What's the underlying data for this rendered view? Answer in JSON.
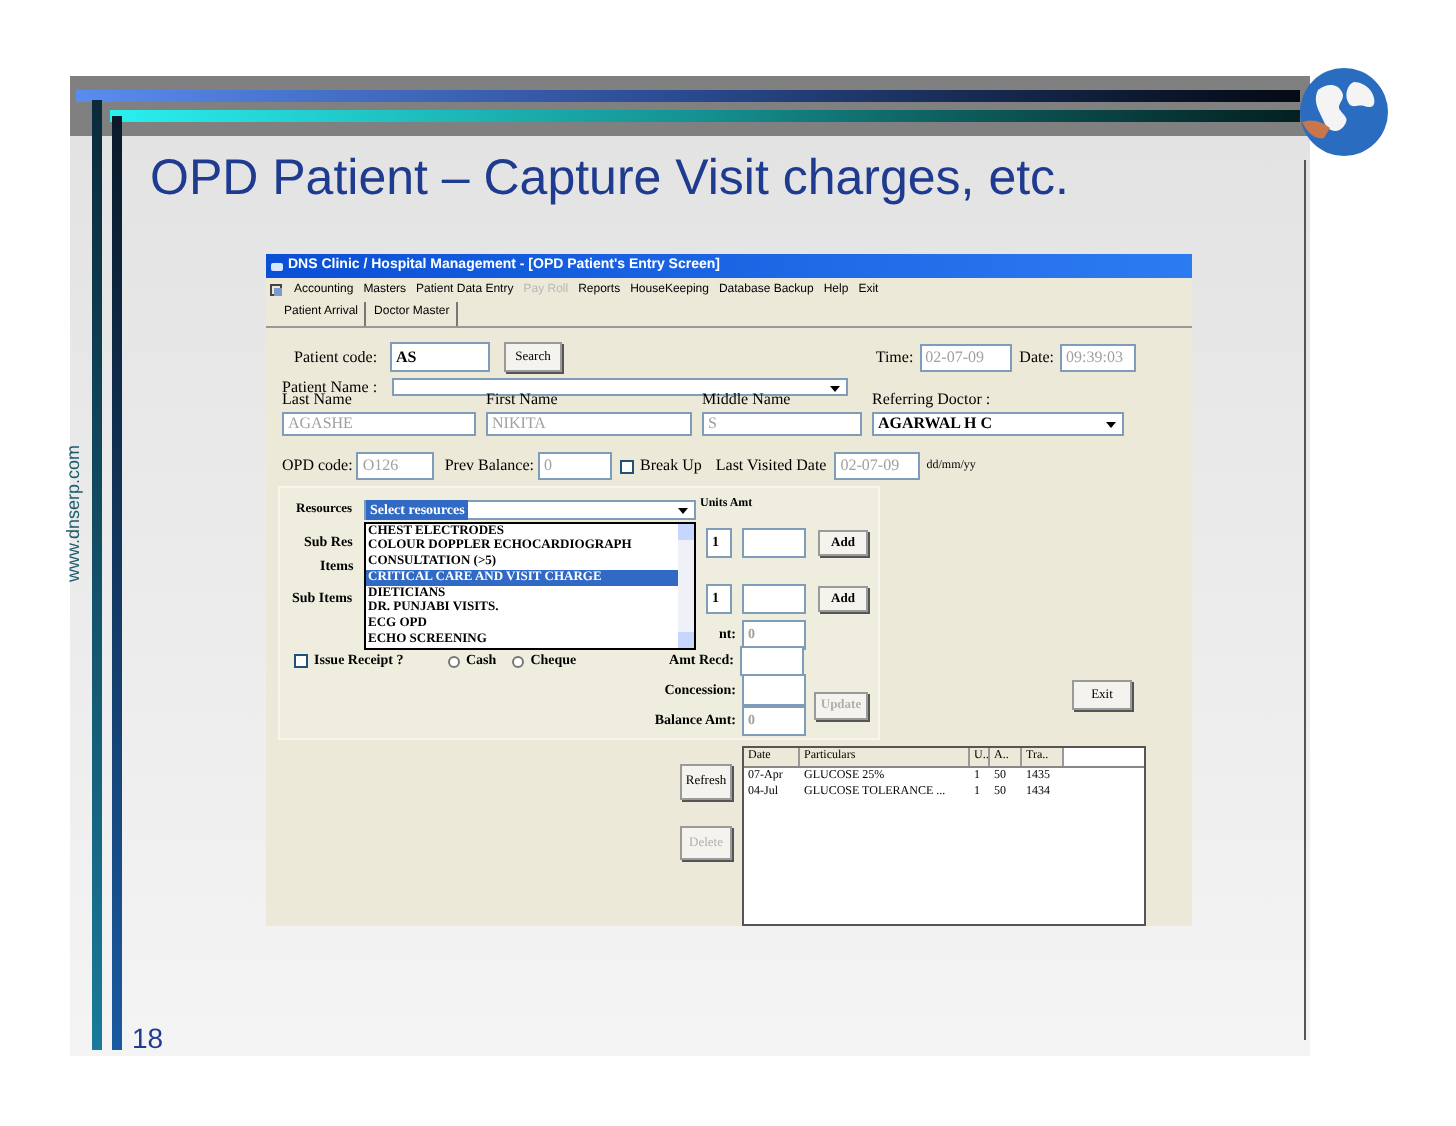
{
  "slide": {
    "title": "OPD Patient – Capture Visit charges, etc.",
    "page_number": "18",
    "side_text": "www.dnserp.com"
  },
  "window": {
    "title": "DNS Clinic / Hospital Management - [OPD Patient's Entry Screen]",
    "menu": [
      {
        "label": "Accounting",
        "disabled": false
      },
      {
        "label": "Masters",
        "disabled": false
      },
      {
        "label": "Patient Data Entry",
        "disabled": false
      },
      {
        "label": "Pay Roll",
        "disabled": true
      },
      {
        "label": "Reports",
        "disabled": false
      },
      {
        "label": "HouseKeeping",
        "disabled": false
      },
      {
        "label": "Database Backup",
        "disabled": false
      },
      {
        "label": "Help",
        "disabled": false
      },
      {
        "label": "Exit",
        "disabled": false
      }
    ],
    "toolbar": [
      "Patient Arrival",
      "Doctor Master"
    ]
  },
  "patient": {
    "code_label": "Patient code:",
    "code": "AS",
    "search_button": "Search",
    "time_label": "Time:",
    "time": "02-07-09",
    "date_label": "Date:",
    "date": "09:39:03",
    "name_label": "Patient Name :",
    "last_name_label": "Last Name",
    "last_name": "AGASHE",
    "first_name_label": "First Name",
    "first_name": "NIKITA",
    "middle_name_label": "Middle Name",
    "middle_name": "S",
    "doctor_label": "Referring Doctor :",
    "doctor": "AGARWAL H C",
    "opd_label": "OPD code:",
    "opd_code": "O126",
    "prev_balance_label": "Prev Balance:",
    "prev_balance": "0",
    "break_up": {
      "label": "Break Up",
      "checked": false
    },
    "last_visited_label": "Last Visited Date",
    "last_visited": "02-07-09",
    "date_format": "dd/mm/yy"
  },
  "charges": {
    "resources_label": "Resources",
    "resources_value": "Select resources",
    "units_amt_label": "Units Amt",
    "options": [
      {
        "label": "CHEST ELECTRODES",
        "selected": false
      },
      {
        "label": "COLOUR DOPPLER ECHOCARDIOGRAPH",
        "selected": false
      },
      {
        "label": "CONSULTATION (>5)",
        "selected": false
      },
      {
        "label": "CRITICAL CARE AND VISIT CHARGE",
        "selected": true
      },
      {
        "label": "DIETICIANS",
        "selected": false
      },
      {
        "label": "DR. PUNJABI VISITS.",
        "selected": false
      },
      {
        "label": "ECG OPD",
        "selected": false
      },
      {
        "label": "ECHO SCREENING",
        "selected": false
      }
    ],
    "sub_res_label": "Sub Res",
    "items_label": "Items",
    "sub_items_label": "Sub Items",
    "entry_rows": [
      {
        "units": "1",
        "add_button": "Add"
      },
      {
        "units": "1",
        "add_button": "Add"
      }
    ],
    "total_label": "nt:",
    "total": "0",
    "issue_receipt": {
      "label": "Issue Receipt ?",
      "checked": false
    },
    "payment_modes": [
      {
        "label": "Cash",
        "selected": false
      },
      {
        "label": "Cheque",
        "selected": false
      }
    ],
    "amt_recd_label": "Amt Recd:",
    "concession_label": "Concession:",
    "balance_label": "Balance Amt:",
    "balance": "0",
    "update_button": {
      "label": "Update",
      "disabled": true
    },
    "exit_button": {
      "label": "Exit",
      "disabled": false
    }
  },
  "history": {
    "refresh_button": {
      "label": "Refresh",
      "disabled": false
    },
    "delete_button": {
      "label": "Delete",
      "disabled": true
    },
    "columns": [
      "Date",
      "Particulars",
      "U..",
      "A..",
      "Tra.."
    ],
    "rows": [
      [
        "07-Apr",
        "GLUCOSE 25%",
        "1",
        "50",
        "1435"
      ],
      [
        "04-Jul",
        "GLUCOSE TOLERANCE ...",
        "1",
        "50",
        "1434"
      ]
    ]
  }
}
